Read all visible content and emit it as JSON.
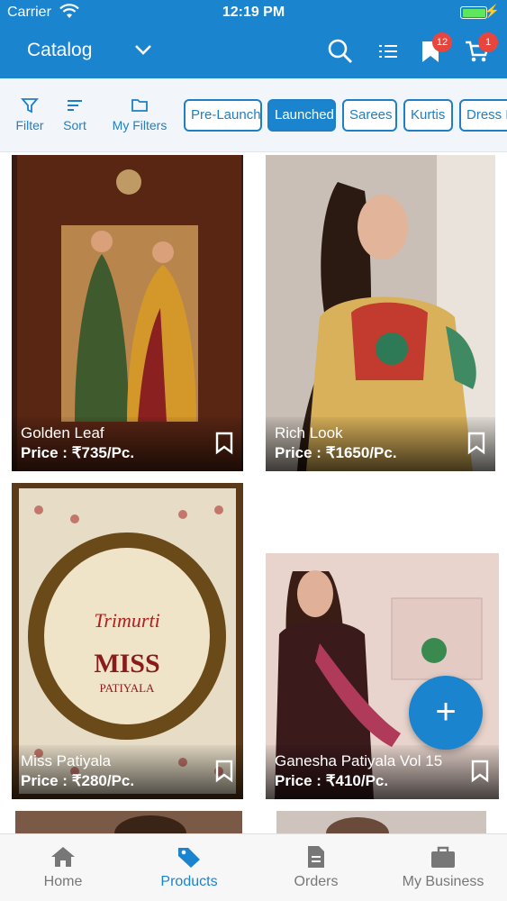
{
  "status": {
    "carrier": "Carrier",
    "time": "12:19 PM"
  },
  "appbar": {
    "title": "Catalog",
    "wishlist_badge": "12",
    "cart_badge": "1",
    "accent": "#1a84cf"
  },
  "toolbar": {
    "filter_label": "Filter",
    "sort_label": "Sort",
    "my_filters_label": "My Filters"
  },
  "chips": [
    "Pre-Launch",
    "Launched",
    "Sarees",
    "Kurtis",
    "Dress M"
  ],
  "active_chip": "Launched",
  "products": [
    {
      "name": "Golden Leaf",
      "price": "Price : ₹735/Pc."
    },
    {
      "name": "Rich Look",
      "price": "Price : ₹1650/Pc."
    },
    {
      "name": "Miss Patiyala",
      "price": "Price : ₹280/Pc."
    },
    {
      "name": "Ganesha Patiyala Vol 15",
      "price": "Price : ₹410/Pc."
    }
  ],
  "fab_label": "+",
  "bottom_nav": [
    {
      "label": "Home",
      "icon": "home-icon"
    },
    {
      "label": "Products",
      "icon": "tag-icon",
      "active": true
    },
    {
      "label": "Orders",
      "icon": "document-icon"
    },
    {
      "label": "My Business",
      "icon": "briefcase-icon"
    }
  ]
}
